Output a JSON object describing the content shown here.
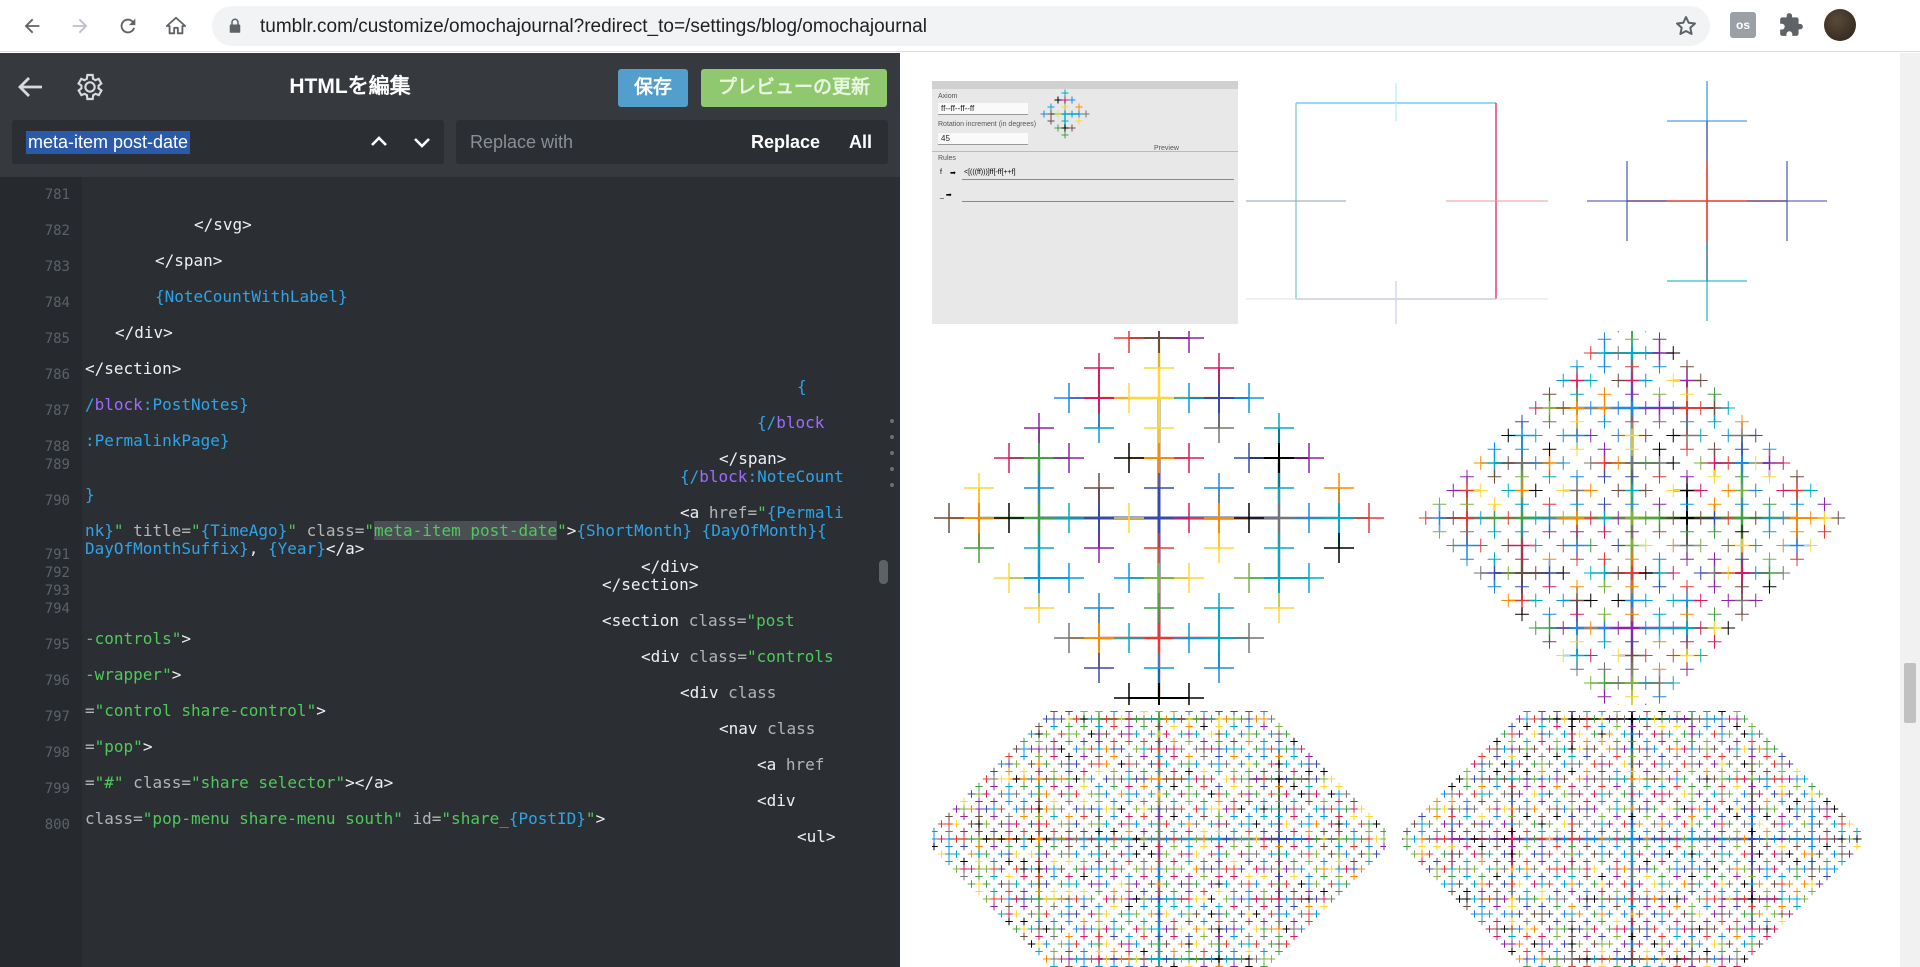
{
  "browser": {
    "url": "tumblr.com/customize/omochajournal?redirect_to=/settings/blog/omochajournal",
    "icons": [
      "back-icon",
      "forward-icon",
      "reload-icon",
      "home-icon",
      "lock-icon",
      "star-icon",
      "lastfm-extension-icon",
      "extensions-puzzle-icon",
      "profile-avatar"
    ]
  },
  "editor": {
    "title": "HTMLを編集",
    "save_label": "保存",
    "preview_label": "プレビューの更新",
    "find_value": "meta-item post-date",
    "replace_placeholder": "Replace with",
    "replace_label": "Replace",
    "all_label": "All",
    "line_numbers": [
      "781",
      "782",
      "783",
      "784",
      "785",
      "786",
      "787",
      "788",
      "789",
      "790",
      "791",
      "792",
      "793",
      "794",
      "795",
      "796",
      "797",
      "798",
      "799",
      "800"
    ]
  },
  "preview": {
    "app_axiom_label": "Axiom",
    "app_axiom_value": "ff--ff--ff--ff",
    "app_rotation_label": "Rotation increment (in degrees)",
    "app_rotation_value": "45",
    "app_preview_label": "Preview",
    "app_rules_label": "Rules",
    "app_rule_key": "f",
    "app_rule_value": "<[(((ff)))]ff[-ff[++f]"
  },
  "colors": {
    "editor_bg": "#2b2f33",
    "editor_header": "#363a3f",
    "save_button": "#529ecc",
    "preview_button": "#8fc86f",
    "string_green": "#4fc95b",
    "variable_blue": "#2ea4e8",
    "keyword_purple": "#9f6bff"
  }
}
